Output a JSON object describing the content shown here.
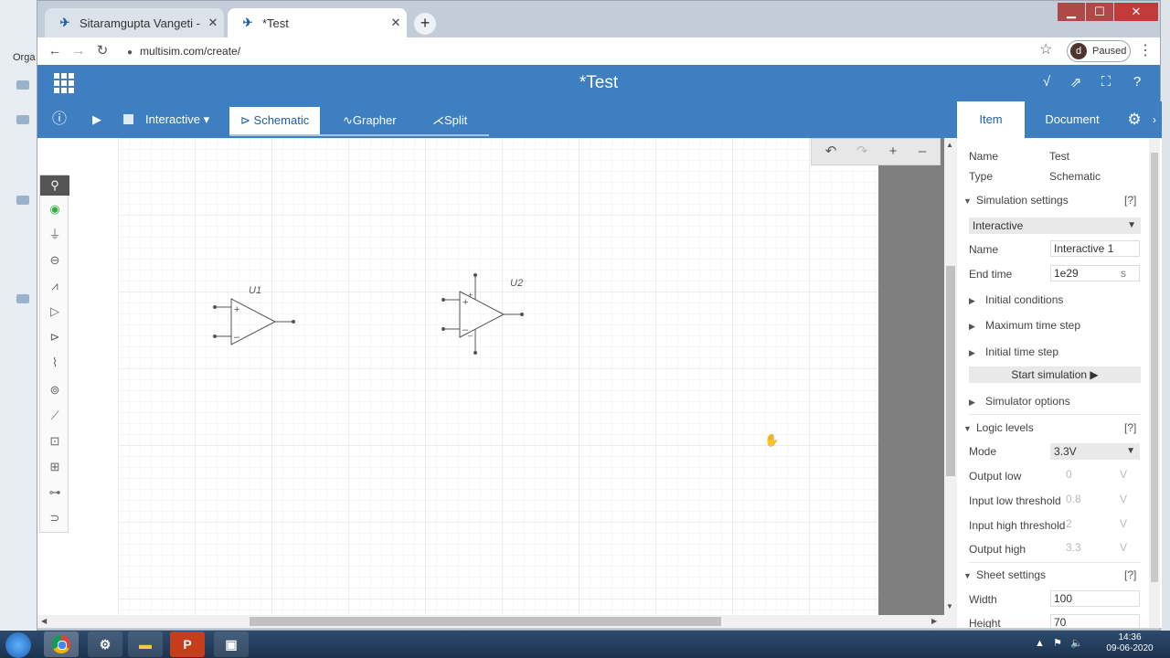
{
  "desktop": {
    "left_text": "Orga"
  },
  "browser": {
    "tabs": [
      {
        "label": "Sitaramgupta Vangeti - M",
        "icon": "multisim-logo-icon"
      },
      {
        "label": "*Test",
        "icon": "multisim-logo-icon"
      }
    ],
    "url": "multisim.com/create/",
    "profile": {
      "initial": "d",
      "status": "Paused"
    }
  },
  "app": {
    "title": "*Test",
    "icons": [
      "probe-icon",
      "share-icon",
      "fullscreen-icon",
      "help-icon"
    ]
  },
  "toolbar": {
    "mode_label": "Interactive",
    "tabs": {
      "schematic": "Schematic",
      "grapher": "Grapher",
      "split": "Split"
    }
  },
  "schematic": {
    "components": [
      {
        "ref": "U1",
        "type": "opamp-3-terminal"
      },
      {
        "ref": "U2",
        "type": "opamp-5-terminal"
      }
    ]
  },
  "panel": {
    "tabs": {
      "item": "Item",
      "document": "Document"
    },
    "name_label": "Name",
    "name_value": "Test",
    "type_label": "Type",
    "type_value": "Schematic",
    "simulation": {
      "title": "Simulation settings",
      "help": "[?]",
      "mode": "Interactive",
      "name_label": "Name",
      "name_value": "Interactive 1",
      "end_time_label": "End time",
      "end_time_value": "1e29",
      "end_time_unit": "s",
      "initial_conditions": "Initial conditions",
      "max_time_step": "Maximum time step",
      "initial_time_step": "Initial time step",
      "start_button": "Start simulation ▶",
      "simulator_options": "Simulator options"
    },
    "logic": {
      "title": "Logic levels",
      "help": "[?]",
      "mode_label": "Mode",
      "mode_value": "3.3V",
      "output_low_label": "Output low",
      "output_low": "0",
      "input_low_label": "Input low threshold",
      "input_low": "0.8",
      "input_high_label": "Input high threshold",
      "input_high": "2",
      "output_high_label": "Output high",
      "output_high": "3.3",
      "unit": "V"
    },
    "sheet": {
      "title": "Sheet settings",
      "help": "[?]",
      "width_label": "Width",
      "width_value": "100",
      "height_label": "Height",
      "height_value": "70"
    }
  },
  "taskbar": {
    "time": "14:36",
    "date": "09-06-2020"
  }
}
